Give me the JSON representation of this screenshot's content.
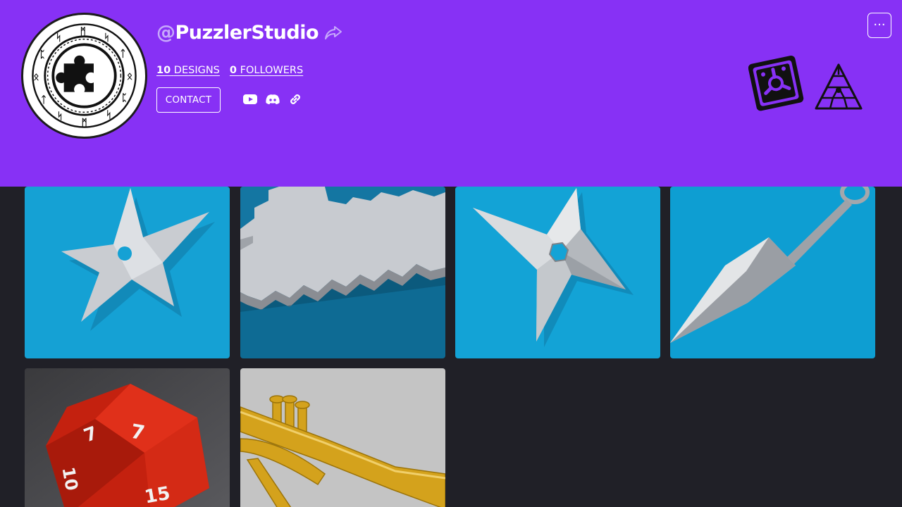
{
  "profile": {
    "at": "@",
    "name": "PuzzlerStudio",
    "designs_count": "10",
    "designs_label": "DESIGNS",
    "followers_count": "0",
    "followers_label": "FOLLOWERS",
    "contact_label": "CONTACT",
    "more_label": "···"
  },
  "colors": {
    "header_bg": "#8731f5",
    "page_bg": "#202027",
    "card_blue": "#13a3d6"
  },
  "icons": {
    "share": "share-icon",
    "social": [
      "youtube-icon",
      "discord-icon",
      "link-icon"
    ],
    "badges": [
      "gear-badge-icon",
      "triangle-cube-badge-icon"
    ]
  },
  "designs": [
    {
      "name": "shuriken-star"
    },
    {
      "name": "pixel-sword"
    },
    {
      "name": "four-point-shuriken"
    },
    {
      "name": "kunai"
    },
    {
      "name": "red-d20-die"
    },
    {
      "name": "golden-trumpet"
    }
  ]
}
